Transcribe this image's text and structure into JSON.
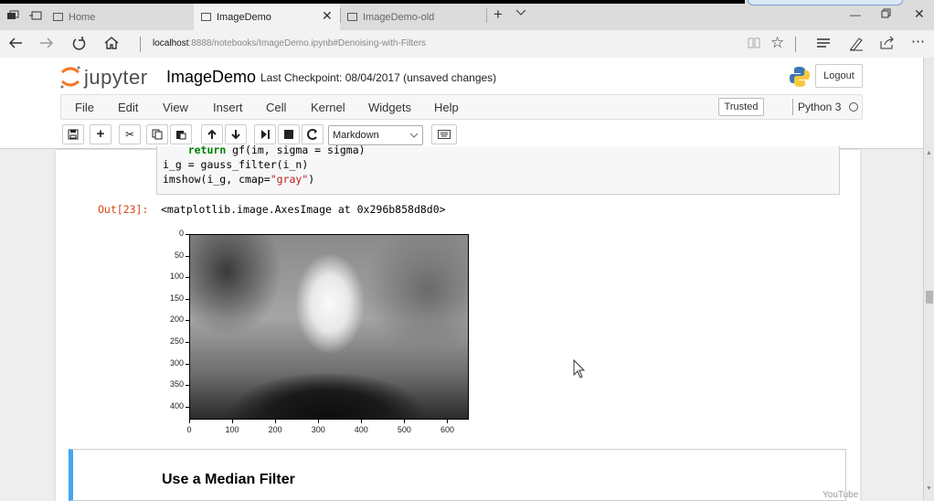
{
  "browser": {
    "tabs": [
      {
        "label": "Home",
        "active": false
      },
      {
        "label": "ImageDemo",
        "active": true
      },
      {
        "label": "ImageDemo-old",
        "active": false
      }
    ],
    "url_host": "localhost",
    "url_path": ":8888/notebooks/ImageDemo.ipynb#Denoising-with-Filters"
  },
  "jupyter": {
    "brand": "jupyter",
    "notebook_name": "ImageDemo",
    "checkpoint": "Last Checkpoint: 08/04/2017 (unsaved changes)",
    "logout_label": "Logout",
    "menu": [
      "File",
      "Edit",
      "View",
      "Insert",
      "Cell",
      "Kernel",
      "Widgets",
      "Help"
    ],
    "trusted_label": "Trusted",
    "kernel_name": "Python 3",
    "cell_type": "Markdown"
  },
  "cells": {
    "code_lines": [
      {
        "indent": "    ",
        "kw": "return",
        "rest": " gf(im, sigma = sigma)"
      },
      {
        "text": "i_g = gauss_filter(i_n)"
      },
      {
        "pre": "imshow(i_g, cmap=",
        "str": "\"gray\"",
        "post": ")"
      }
    ],
    "out_prompt": "Out[23]:",
    "out_text": "<matplotlib.image.AxesImage at 0x296b858d8d0>",
    "markdown_heading": "Use a Median Filter"
  },
  "chart_data": {
    "type": "image",
    "yticks": [
      "0",
      "50",
      "100",
      "150",
      "200",
      "250",
      "300",
      "350",
      "400"
    ],
    "xticks": [
      "0",
      "100",
      "200",
      "300",
      "400",
      "500",
      "600"
    ],
    "xlim": [
      0,
      650
    ],
    "ylim": [
      430,
      0
    ]
  },
  "watermark": "YouTube"
}
